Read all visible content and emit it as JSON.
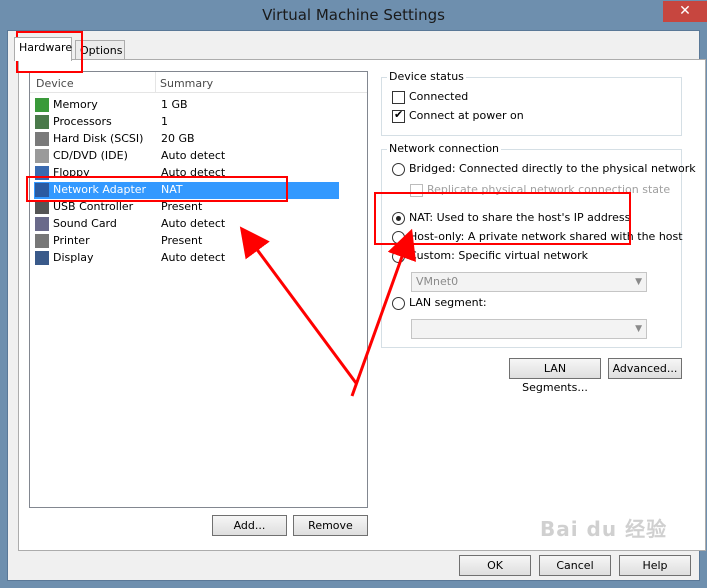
{
  "window": {
    "title": "Virtual Machine Settings",
    "close_label": "✕"
  },
  "tabs": [
    {
      "label": "Hardware",
      "active": true
    },
    {
      "label": "Options",
      "active": false
    }
  ],
  "device_list": {
    "columns": [
      "Device",
      "Summary"
    ],
    "rows": [
      {
        "name": "Memory",
        "summary": "1 GB",
        "icon": "memory-icon"
      },
      {
        "name": "Processors",
        "summary": "1",
        "icon": "processor-icon"
      },
      {
        "name": "Hard Disk (SCSI)",
        "summary": "20 GB",
        "icon": "hard-disk-icon"
      },
      {
        "name": "CD/DVD (IDE)",
        "summary": "Auto detect",
        "icon": "cd-dvd-icon"
      },
      {
        "name": "Floppy",
        "summary": "Auto detect",
        "icon": "floppy-icon"
      },
      {
        "name": "Network Adapter",
        "summary": "NAT",
        "icon": "network-adapter-icon",
        "selected": true
      },
      {
        "name": "USB Controller",
        "summary": "Present",
        "icon": "usb-icon"
      },
      {
        "name": "Sound Card",
        "summary": "Auto detect",
        "icon": "sound-card-icon"
      },
      {
        "name": "Printer",
        "summary": "Present",
        "icon": "printer-icon"
      },
      {
        "name": "Display",
        "summary": "Auto detect",
        "icon": "display-icon"
      }
    ],
    "add_label": "Add...",
    "remove_label": "Remove"
  },
  "device_status": {
    "title": "Device status",
    "connected_label": "Connected",
    "connected": false,
    "connect_power_label": "Connect at power on",
    "connect_power": true
  },
  "network_connection": {
    "title": "Network connection",
    "bridged_label": "Bridged: Connected directly to the physical network",
    "replicate_label": "Replicate physical network connection state",
    "nat_label": "NAT: Used to share the host's IP address",
    "hostonly_label": "Host-only: A private network shared with the host",
    "custom_label": "Custom: Specific virtual network",
    "custom_value": "VMnet0",
    "lan_label": "LAN segment:",
    "lan_value": "",
    "selected": "NAT"
  },
  "buttons": {
    "lan_segments": "LAN Segments...",
    "advanced": "Advanced...",
    "ok": "OK",
    "cancel": "Cancel",
    "help": "Help"
  },
  "watermark": "Bai du 经验",
  "annotation_color": "#ff0000",
  "selection_color": "#3399ff"
}
